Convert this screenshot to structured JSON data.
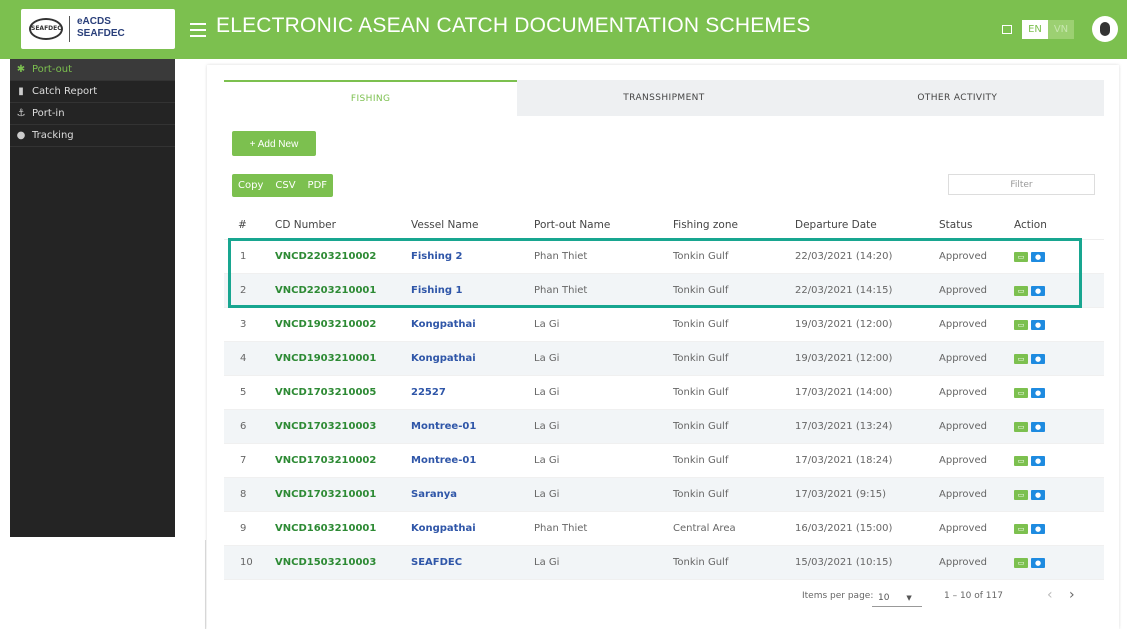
{
  "header": {
    "logo_text_line1": "eACDS",
    "logo_text_line2": "SEAFDEC",
    "title": "ELECTRONIC ASEAN CATCH DOCUMENTATION SCHEMES",
    "lang_en": "EN",
    "lang_vn": "VN"
  },
  "sidebar": {
    "items": [
      {
        "label": "Port-out",
        "icon": "gear-icon"
      },
      {
        "label": "Catch Report",
        "icon": "document-icon"
      },
      {
        "label": "Port-in",
        "icon": "anchor-icon"
      },
      {
        "label": "Tracking",
        "icon": "location-pin-icon"
      }
    ]
  },
  "tabs": [
    "FISHING",
    "TRANSSHIPMENT",
    "OTHER ACTIVITY"
  ],
  "toolbar": {
    "add_label": "+ Add New",
    "copy_label": "Copy",
    "csv_label": "CSV",
    "pdf_label": "PDF",
    "filter_placeholder": "Filter"
  },
  "table": {
    "columns": [
      "#",
      "CD Number",
      "Vessel Name",
      "Port-out Name",
      "Fishing zone",
      "Departure Date",
      "Status",
      "Action"
    ],
    "rows": [
      {
        "n": "1",
        "cd": "VNCD2203210002",
        "vessel": "Fishing 2",
        "port": "Phan Thiet",
        "zone": "Tonkin Gulf",
        "date": "22/03/2021 (14:20)",
        "status": "Approved"
      },
      {
        "n": "2",
        "cd": "VNCD2203210001",
        "vessel": "Fishing 1",
        "port": "Phan Thiet",
        "zone": "Tonkin Gulf",
        "date": "22/03/2021 (14:15)",
        "status": "Approved"
      },
      {
        "n": "3",
        "cd": "VNCD1903210002",
        "vessel": "Kongpathai",
        "port": "La Gi",
        "zone": "Tonkin Gulf",
        "date": "19/03/2021 (12:00)",
        "status": "Approved"
      },
      {
        "n": "4",
        "cd": "VNCD1903210001",
        "vessel": "Kongpathai",
        "port": "La Gi",
        "zone": "Tonkin Gulf",
        "date": "19/03/2021 (12:00)",
        "status": "Approved"
      },
      {
        "n": "5",
        "cd": "VNCD1703210005",
        "vessel": "22527",
        "port": "La Gi",
        "zone": "Tonkin Gulf",
        "date": "17/03/2021 (14:00)",
        "status": "Approved"
      },
      {
        "n": "6",
        "cd": "VNCD1703210003",
        "vessel": "Montree-01",
        "port": "La Gi",
        "zone": "Tonkin Gulf",
        "date": "17/03/2021 (13:24)",
        "status": "Approved"
      },
      {
        "n": "7",
        "cd": "VNCD1703210002",
        "vessel": "Montree-01",
        "port": "La Gi",
        "zone": "Tonkin Gulf",
        "date": "17/03/2021 (18:24)",
        "status": "Approved"
      },
      {
        "n": "8",
        "cd": "VNCD1703210001",
        "vessel": "Saranya",
        "port": "La Gi",
        "zone": "Tonkin Gulf",
        "date": "17/03/2021 (9:15)",
        "status": "Approved"
      },
      {
        "n": "9",
        "cd": "VNCD1603210001",
        "vessel": "Kongpathai",
        "port": "Phan Thiet",
        "zone": "Central Area",
        "date": "16/03/2021 (15:00)",
        "status": "Approved"
      },
      {
        "n": "10",
        "cd": "VNCD1503210003",
        "vessel": "SEAFDEC",
        "port": "La Gi",
        "zone": "Tonkin Gulf",
        "date": "15/03/2021 (10:15)",
        "status": "Approved"
      }
    ]
  },
  "pagination": {
    "items_per_page_label": "Items per page:",
    "items_per_page_value": "10",
    "range": "1 – 10 of 117"
  },
  "colors": {
    "brand_green": "#7cc04f",
    "highlight_teal": "#18a690",
    "link_blue": "#2f56a8",
    "cd_green": "#2d8a34"
  }
}
